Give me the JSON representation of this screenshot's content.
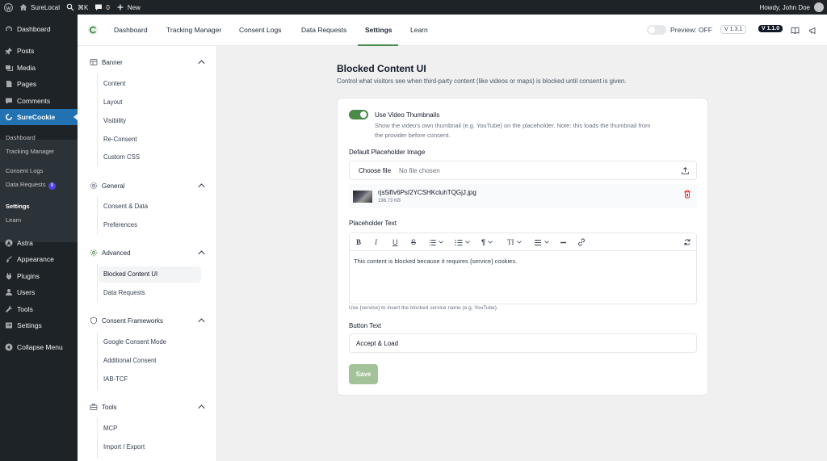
{
  "admin_bar": {
    "site_name": "SureLocal",
    "shortcut": "⌘K",
    "comments_count": "0",
    "new_label": "New",
    "howdy": "Howdy, John Doe"
  },
  "sidebar": {
    "dashboard": "Dashboard",
    "posts": "Posts",
    "media": "Media",
    "pages": "Pages",
    "comments": "Comments",
    "surecookie": "SureCookie",
    "sub_dashboard": "Dashboard",
    "sub_tracking": "Tracking Manager",
    "sub_consent_logs": "Consent Logs",
    "sub_data_requests": "Data Requests",
    "sub_data_requests_badge": "9",
    "sub_settings": "Settings",
    "sub_learn": "Learn",
    "astra": "Astra",
    "appearance": "Appearance",
    "plugins": "Plugins",
    "users": "Users",
    "tools": "Tools",
    "settings": "Settings",
    "collapse": "Collapse Menu"
  },
  "top_nav": {
    "tabs": [
      "Dashboard",
      "Tracking Manager",
      "Consent Logs",
      "Data Requests",
      "Settings",
      "Learn"
    ],
    "active_tab": "Settings",
    "preview_label": "Preview: OFF",
    "version_free": "V 1.3.1",
    "version_pro": "V 1.1.0"
  },
  "settings_nav": {
    "banner": {
      "title": "Banner",
      "items": [
        "Content",
        "Layout",
        "Visibility",
        "Re-Consent",
        "Custom CSS"
      ]
    },
    "general": {
      "title": "General",
      "items": [
        "Consent & Data",
        "Preferences"
      ]
    },
    "advanced": {
      "title": "Advanced",
      "items": [
        "Blocked Content UI",
        "Data Requests"
      ]
    },
    "frameworks": {
      "title": "Consent Frameworks",
      "items": [
        "Google Consent Mode",
        "Additional Consent",
        "IAB-TCF"
      ]
    },
    "tools": {
      "title": "Tools",
      "items": [
        "MCP",
        "Import / Export"
      ]
    }
  },
  "main": {
    "title": "Blocked Content UI",
    "description": "Control what visitors see when third-party content (like videos or maps) is blocked until consent is given.",
    "video_thumb_label": "Use Video Thumbnails",
    "video_thumb_help_1": "Show the video's own thumbnail (e.g. YouTube) on the placeholder. Note: this loads the thumbnail from",
    "video_thumb_help_2": "the provider before consent.",
    "video_thumb_enabled": true,
    "placeholder_image_label": "Default Placeholder Image",
    "choose_file": "Choose file",
    "no_file": "No file chosen",
    "file_name": "rjs5ifIv6PsI2YCSHKcluhTQGjJ.jpg",
    "file_size": "198.73 KB",
    "placeholder_text_label": "Placeholder Text",
    "placeholder_text_value": "This content is blocked because it requires {service} cookies.",
    "placeholder_hint": "Use {service} to insert the blocked service name (e.g. YouTube).",
    "button_text_label": "Button Text",
    "button_text_value": "Accept & Load",
    "save_label": "Save"
  },
  "colors": {
    "accent_green": "#4a8a4a",
    "save_disabled": "#a3c29a",
    "wp_active": "#2271b1",
    "wp_dark": "#1d2327"
  }
}
